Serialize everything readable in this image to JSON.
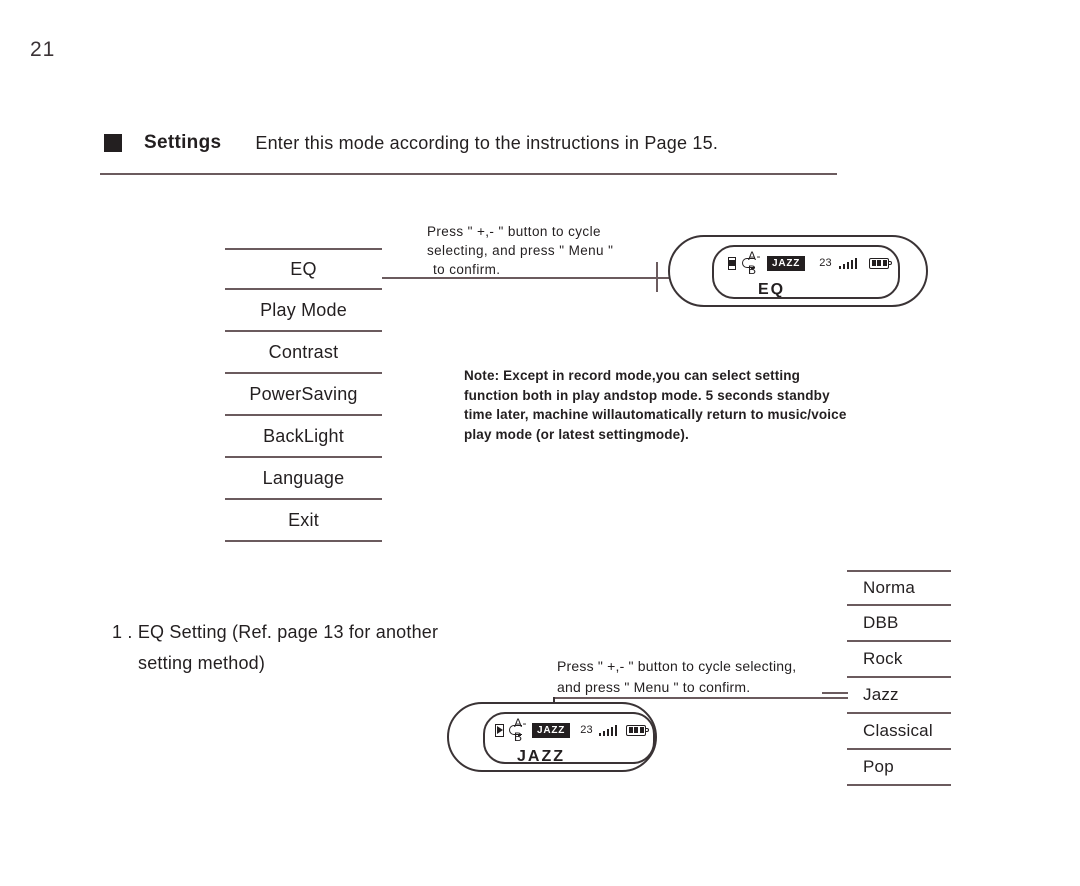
{
  "page": {
    "number": "21"
  },
  "header": {
    "bullet_icon": "filled-square-icon",
    "title": "Settings",
    "description": "Enter this mode according to the instructions in Page 15."
  },
  "settings_menu": {
    "items": [
      {
        "label": "EQ"
      },
      {
        "label": "Play Mode"
      },
      {
        "label": "Contrast"
      },
      {
        "label": "PowerSaving"
      },
      {
        "label": "BackLight"
      },
      {
        "label": "Language"
      },
      {
        "label": "Exit"
      }
    ]
  },
  "instruction_top": {
    "line1": "Press  \" +,- \" button to cycle",
    "line2": "selecting, and press \" Menu \"",
    "line3": "to confirm."
  },
  "device_top": {
    "status": {
      "transport_icon": "stop-icon",
      "repeat_icon": "repeat-icon",
      "ab_label": "A- B",
      "eq_badge": "JAZZ",
      "track_number": "23",
      "signal_icon": "signal-bars-icon",
      "battery_icon": "battery-icon"
    },
    "screen_text": "EQ"
  },
  "note": {
    "line1": "Note: Except in record mode,you can select setting",
    "line2": "function both in play andstop mode. 5 seconds standby",
    "line3": "time later, machine willautomatically return to music/voice",
    "line4": "play mode (or latest settingmode)."
  },
  "eq_caption": {
    "line1": "1 . EQ Setting (Ref. page 13 for another",
    "line2": "setting method)"
  },
  "instruction_bottom": {
    "line1": "Press  \" +,- \" button to cycle selecting,",
    "line2": "and press  \" Menu \"  to confirm."
  },
  "device_bottom": {
    "status": {
      "transport_icon": "play-icon",
      "repeat_icon": "repeat-icon",
      "ab_label": "A- B",
      "eq_badge": "JAZZ",
      "track_number": "23",
      "signal_icon": "signal-bars-icon",
      "battery_icon": "battery-icon"
    },
    "screen_text": "JAZZ"
  },
  "eq_options": {
    "items": [
      {
        "label": "Norma"
      },
      {
        "label": "DBB"
      },
      {
        "label": "Rock"
      },
      {
        "label": "Jazz"
      },
      {
        "label": "Classical"
      },
      {
        "label": "Pop"
      }
    ]
  },
  "colors": {
    "ink": "#231f20",
    "rule": "#6b5b5e",
    "paper": "#ffffff"
  }
}
